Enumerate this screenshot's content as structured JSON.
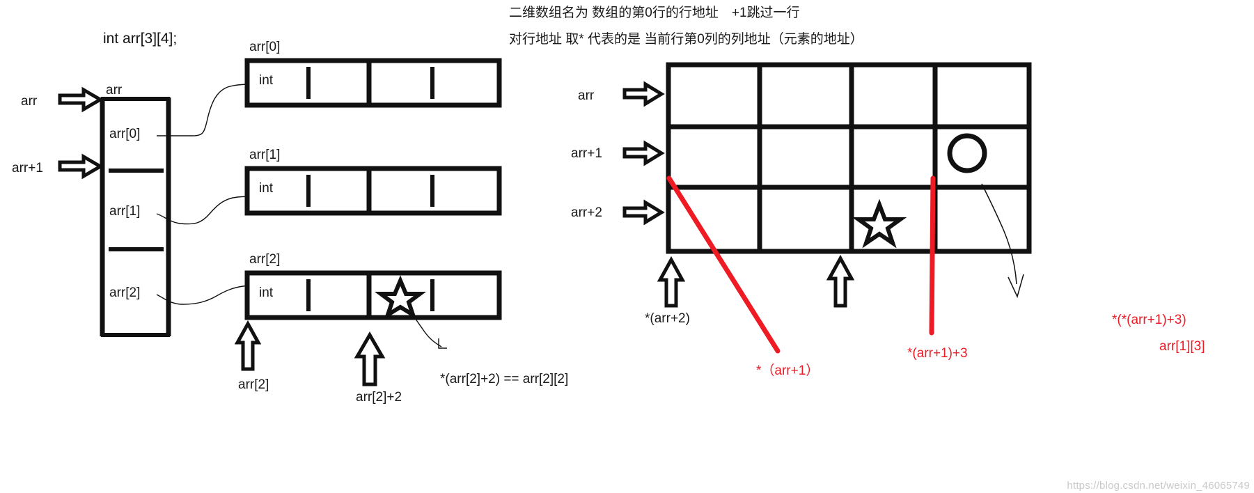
{
  "notes": {
    "line1": "二维数组名为 数组的第0行的行地址　+1跳过一行",
    "line2": "对行地址 取* 代表的是 当前行第0列的列地址（元素的地址）"
  },
  "left": {
    "declaration": "int arr[3][4];",
    "column_box": {
      "top_label": "arr",
      "row_labels": [
        "arr[0]",
        "arr[1]",
        "arr[2]"
      ]
    },
    "pointer_arrows": [
      {
        "label": "arr"
      },
      {
        "label": "arr+1"
      }
    ],
    "rows": [
      {
        "title": "arr[0]",
        "cell_type": "int",
        "cells": 4,
        "star_cell": null
      },
      {
        "title": "arr[1]",
        "cell_type": "int",
        "cells": 4,
        "star_cell": null
      },
      {
        "title": "arr[2]",
        "cell_type": "int",
        "cells": 4,
        "star_cell": 2
      }
    ],
    "bottom_arrow_labels": [
      "arr[2]",
      "arr[2]+2"
    ],
    "equation": "*(arr[2]+2) == arr[2][2]"
  },
  "right": {
    "row_arrow_labels": [
      "arr",
      "arr+1",
      "arr+2"
    ],
    "grid": {
      "rows": 3,
      "cols": 4
    },
    "marks": {
      "star_cell": "row3-col3",
      "circle_cell": "row2-col4"
    },
    "bottom_arrow_labels": [
      "*(arr+2)"
    ],
    "red_labels": {
      "diagonal": "*（arr+1）",
      "vertical": "*(arr+1)+3",
      "element_expr": "*(*(arr+1)+3)",
      "element_index": "arr[1][3]"
    }
  },
  "colors": {
    "red": "#ee1b24",
    "ink": "#111111",
    "watermark": "#c9c9c9"
  },
  "watermark": "https://blog.csdn.net/weixin_46065749"
}
